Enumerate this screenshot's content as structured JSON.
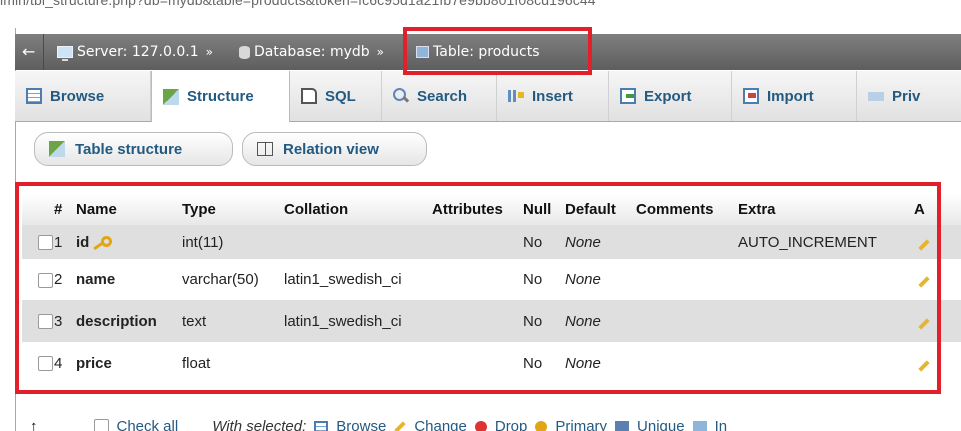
{
  "url": {
    "text": "lmin/tbl_structure.php?db=mydb&table=products&token=fc6c95d1a21fb7e9bb801f08cd196c44"
  },
  "breadcrumb": {
    "collapse_glyph": "←",
    "server": "Server: 127.0.0.1",
    "database": "Database: mydb",
    "table": "Table: products",
    "separator": "»"
  },
  "tabs": [
    {
      "label": "Browse",
      "icon": "browse-icon"
    },
    {
      "label": "Structure",
      "icon": "structure-icon",
      "active": true
    },
    {
      "label": "SQL",
      "icon": "sql-icon"
    },
    {
      "label": "Search",
      "icon": "search-icon"
    },
    {
      "label": "Insert",
      "icon": "insert-icon"
    },
    {
      "label": "Export",
      "icon": "export-icon"
    },
    {
      "label": "Import",
      "icon": "import-icon"
    },
    {
      "label": "Priv",
      "icon": "privileges-icon"
    }
  ],
  "subnav": {
    "table_structure": "Table structure",
    "relation_view": "Relation view"
  },
  "table": {
    "headers": {
      "num": "#",
      "name": "Name",
      "type": "Type",
      "collation": "Collation",
      "attributes": "Attributes",
      "null": "Null",
      "default": "Default",
      "comments": "Comments",
      "extra": "Extra",
      "action": "A"
    },
    "rows": [
      {
        "num": "1",
        "name": "id",
        "type": "int(11)",
        "collation": "",
        "attributes": "",
        "null": "No",
        "default": "None",
        "comments": "",
        "extra": "AUTO_INCREMENT",
        "primary_key": true
      },
      {
        "num": "2",
        "name": "name",
        "type": "varchar(50)",
        "collation": "latin1_swedish_ci",
        "attributes": "",
        "null": "No",
        "default": "None",
        "comments": "",
        "extra": ""
      },
      {
        "num": "3",
        "name": "description",
        "type": "text",
        "collation": "latin1_swedish_ci",
        "attributes": "",
        "null": "No",
        "default": "None",
        "comments": "",
        "extra": ""
      },
      {
        "num": "4",
        "name": "price",
        "type": "float",
        "collation": "",
        "attributes": "",
        "null": "No",
        "default": "None",
        "comments": "",
        "extra": ""
      }
    ]
  },
  "bottom": {
    "arrow": "↑",
    "check_all": "Check all",
    "with_selected": "With selected:",
    "browse": "Browse",
    "change": "Change",
    "drop": "Drop",
    "primary": "Primary",
    "unique": "Unique",
    "index": "In"
  },
  "colors": {
    "highlight": "#e2202c",
    "link": "#235a81",
    "topbar": "#6e6e6e"
  }
}
